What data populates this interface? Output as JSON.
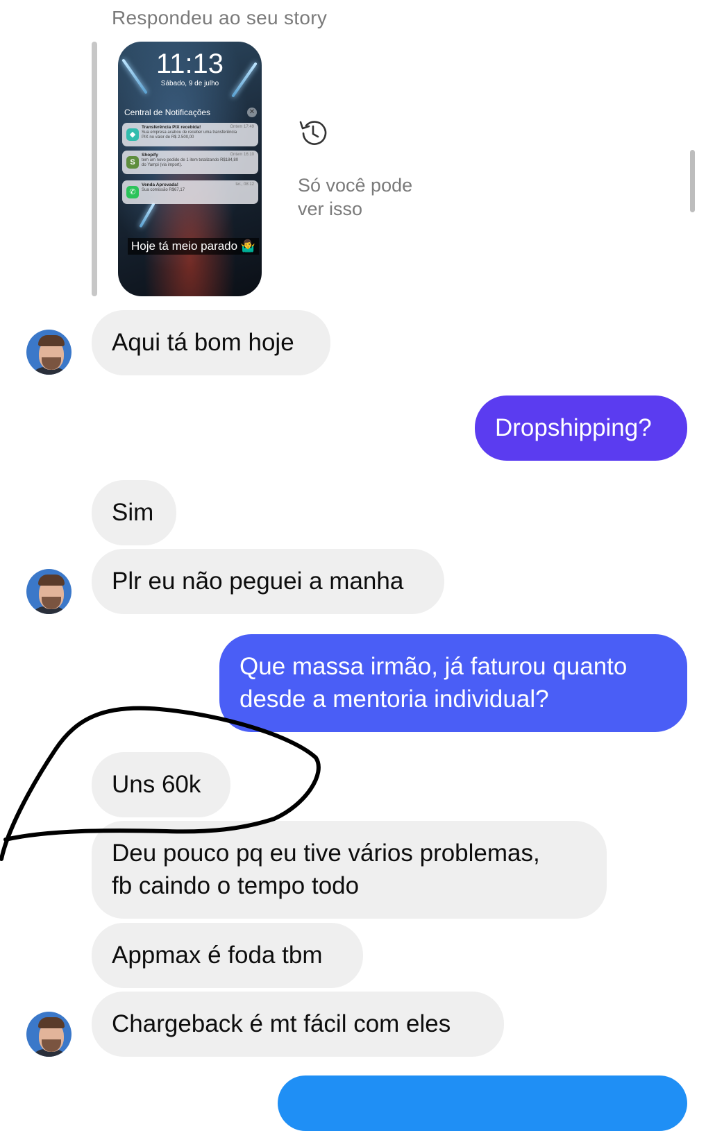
{
  "story": {
    "reply_label": "Respondeu ao seu story",
    "thumbnail": {
      "time": "11:13",
      "date": "Sábado, 9 de julho",
      "notification_center": "Central de Notificações",
      "notifications": [
        {
          "app_icon": "pix-icon",
          "icon_color": "#32bcad",
          "title": "Transferência PIX recebida!",
          "body": "Sua empresa acabou de receber uma transferência PIX no valor de R$ 2.500,00",
          "time": "Ontem 17:49"
        },
        {
          "app_icon": "shopify-icon",
          "icon_color": "#5e8e3e",
          "title": "Shopify",
          "body": "tem um novo pedido de 1 item totalizando R$184,80 do Yampi (via import).",
          "time": "Ontem 16:10"
        },
        {
          "app_icon": "phone-icon",
          "icon_color": "#2bc35a",
          "title": "Venda Aprovada!",
          "body": "Sua comissão R$67,17",
          "time": "ter., 08:12"
        }
      ],
      "caption": "Hoje tá meio parado 🤷‍♂️"
    },
    "expired_icon": "history-icon",
    "expired_text_line1": "Só você pode",
    "expired_text_line2": "ver isso"
  },
  "messages": [
    {
      "from": "them",
      "text": "Aqui tá bom hoje"
    },
    {
      "from": "me",
      "text": "Dropshipping?"
    },
    {
      "from": "them",
      "text": "Sim"
    },
    {
      "from": "them",
      "text": "Plr eu não peguei a manha"
    },
    {
      "from": "me",
      "text_line1": "Que massa irmão, já faturou quanto",
      "text_line2": "desde a mentoria individual?"
    },
    {
      "from": "them",
      "text": "Uns 60k"
    },
    {
      "from": "them",
      "text_line1": "Deu pouco pq eu tive vários problemas,",
      "text_line2": "fb caindo o tempo todo"
    },
    {
      "from": "them",
      "text": "Appmax é foda tbm"
    },
    {
      "from": "them",
      "text": "Chargeback é mt fácil com eles"
    }
  ],
  "colors": {
    "outgoing_purple": "#5b3cf0",
    "outgoing_blue": "#4a5ef6",
    "incoming_bubble": "#efefef",
    "annotation_stroke": "#000000"
  }
}
